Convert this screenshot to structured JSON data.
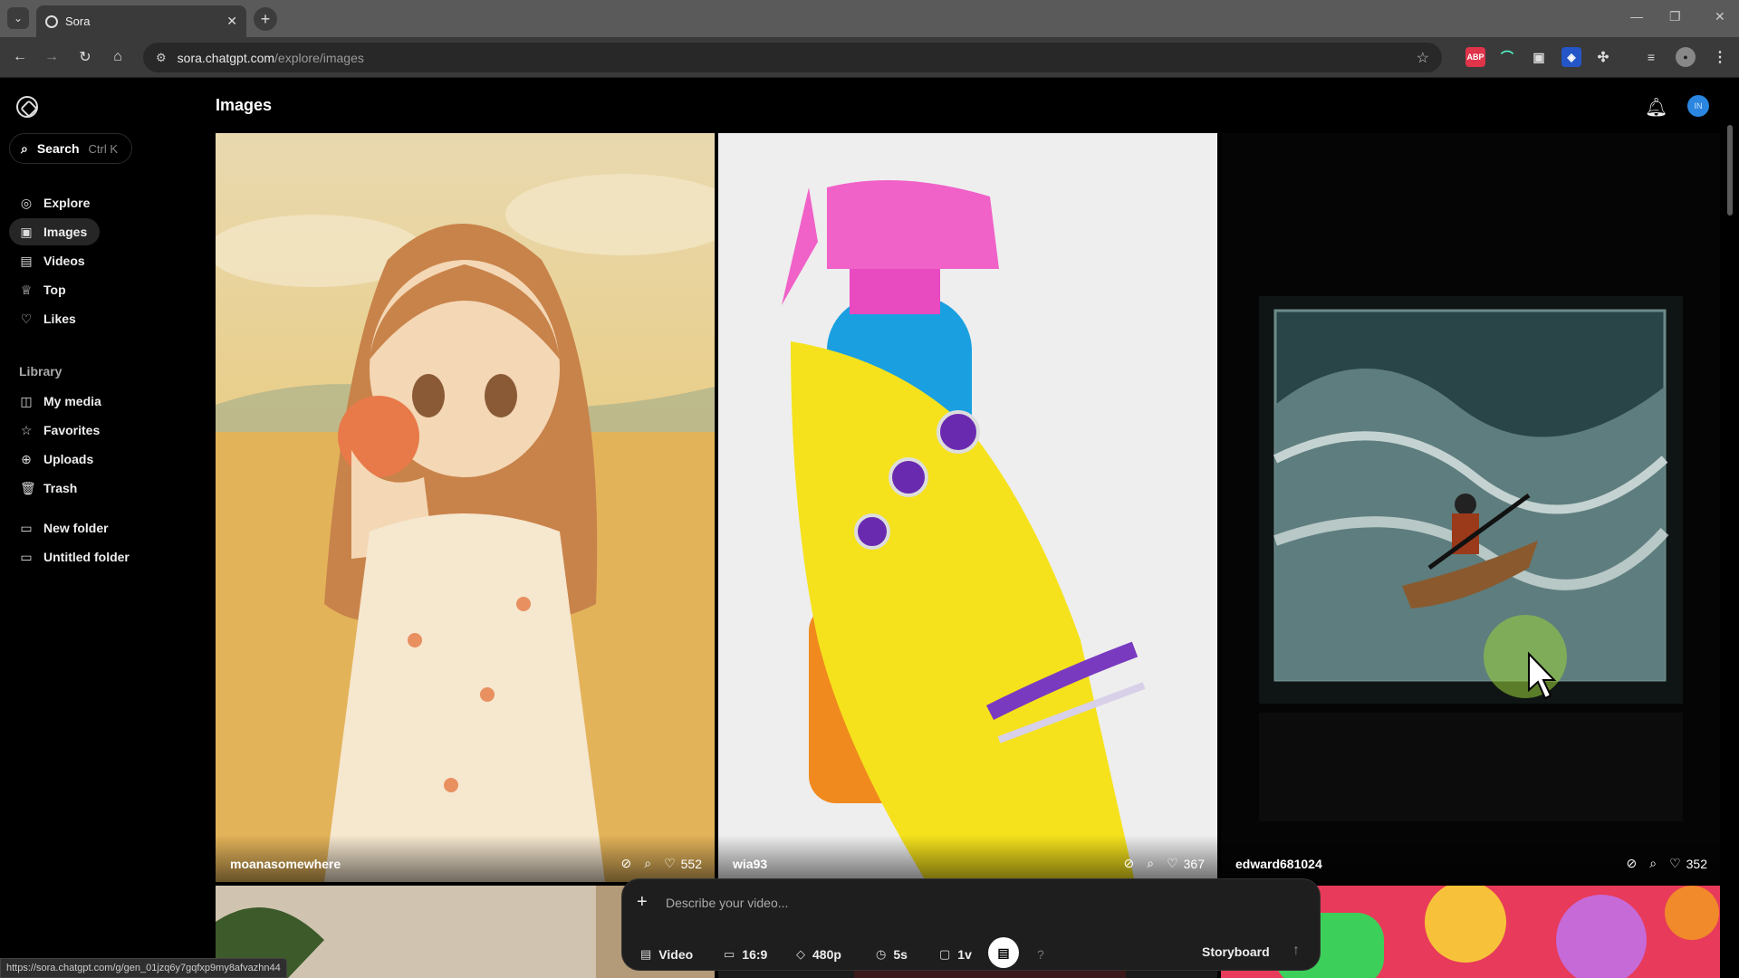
{
  "browser": {
    "tab_title": "Sora",
    "url_host": "sora.chatgpt.com",
    "url_path": "/explore/images",
    "status_url": "https://sora.chatgpt.com/g/gen_01jzq6y7gqfxp9my8afvazhn44",
    "extensions": [
      "ABP"
    ]
  },
  "sidebar": {
    "search_label": "Search",
    "search_shortcut": "Ctrl K",
    "nav": [
      {
        "label": "Explore",
        "icon": "compass-icon"
      },
      {
        "label": "Images",
        "icon": "image-icon"
      },
      {
        "label": "Videos",
        "icon": "video-icon"
      },
      {
        "label": "Top",
        "icon": "trophy-icon"
      },
      {
        "label": "Likes",
        "icon": "heart-icon"
      }
    ],
    "library_label": "Library",
    "library": [
      {
        "label": "My media",
        "icon": "media-icon"
      },
      {
        "label": "Favorites",
        "icon": "star-icon"
      },
      {
        "label": "Uploads",
        "icon": "upload-icon"
      },
      {
        "label": "Trash",
        "icon": "trash-icon"
      }
    ],
    "folders": [
      {
        "label": "New folder",
        "icon": "folder-icon"
      },
      {
        "label": "Untitled folder",
        "icon": "folder-icon"
      }
    ]
  },
  "header": {
    "title": "Images",
    "avatar_initials": "IN"
  },
  "cards": [
    {
      "user": "moanasomewhere",
      "likes": "552"
    },
    {
      "user": "wia93",
      "likes": "367"
    },
    {
      "user": "edward681024",
      "likes": "352"
    }
  ],
  "composer": {
    "placeholder": "Describe your video...",
    "type": "Video",
    "aspect": "16:9",
    "resolution": "480p",
    "duration": "5s",
    "variations": "1v",
    "storyboard": "Storyboard"
  },
  "colors": {
    "accent_avatar": "#2a86e0",
    "background": "#000000"
  }
}
